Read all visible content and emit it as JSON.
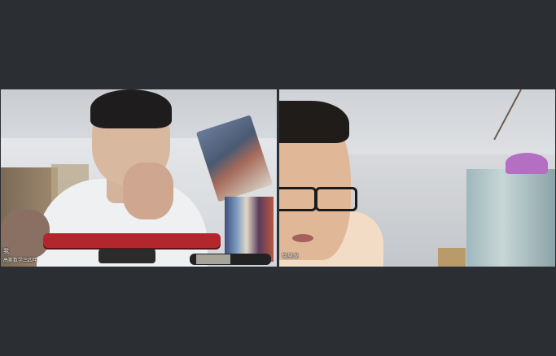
{
  "participants": [
    {
      "name": "我",
      "subtitle": "高斯数学三四年"
    },
    {
      "name": "何昊龙"
    }
  ],
  "colors": {
    "background": "#2b2e33",
    "name_text": "#ffffff"
  }
}
